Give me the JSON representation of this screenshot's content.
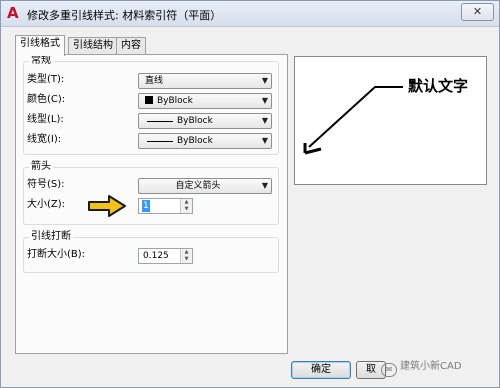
{
  "window": {
    "title": "修改多重引线样式: 材料索引符（平面）",
    "close_symbol": "✕",
    "app_icon_glyph": "A"
  },
  "tabs": [
    {
      "label": "引线格式",
      "active": true
    },
    {
      "label": "引线结构",
      "active": false
    },
    {
      "label": "内容",
      "active": false
    }
  ],
  "general": {
    "title": "常规",
    "type_label": "类型(T):",
    "type_value": "直线",
    "color_label": "颜色(C):",
    "color_value": "ByBlock",
    "linetype_label": "线型(L):",
    "linetype_value": "ByBlock",
    "lineweight_label": "线宽(I):",
    "lineweight_value": "ByBlock"
  },
  "arrowhead": {
    "title": "箭头",
    "symbol_label": "符号(S):",
    "symbol_value": "自定义箭头",
    "size_label": "大小(Z):",
    "size_value": "1"
  },
  "leader_break": {
    "title": "引线打断",
    "break_size_label": "打断大小(B):",
    "break_size_value": "0.125"
  },
  "preview": {
    "text": "默认文字"
  },
  "buttons": {
    "ok_label": "确定",
    "cancel_label": "取"
  },
  "watermark": {
    "text": "建筑小新CAD",
    "logo_glyph": "✉"
  },
  "colors": {
    "accent_arrow": "#f0c419",
    "selection": "#3399ff",
    "app_icon": "#c8102e"
  },
  "icons": {
    "combo_arrow": "▼",
    "spin_up": "▲",
    "spin_down": "▼"
  }
}
